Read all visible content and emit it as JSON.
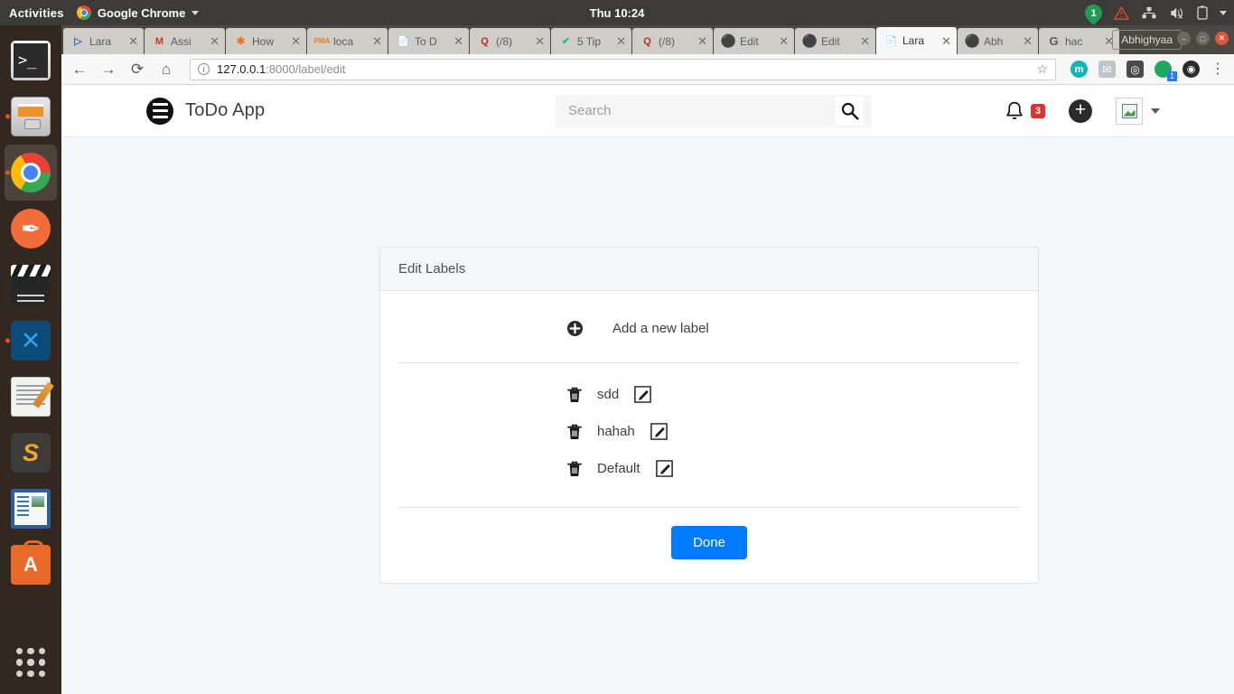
{
  "desktop": {
    "activities_label": "Activities",
    "active_app": "Google Chrome",
    "clock": "Thu 10:24",
    "tray": {
      "message_count": "1",
      "warning_icon": "warning-triangle-icon",
      "network_icon": "network-wired-icon",
      "volume_icon": "volume-muted-icon",
      "battery_icon": "battery-icon",
      "menu_icon": "chevron-down-icon"
    },
    "dock": [
      {
        "name": "terminal",
        "label": "Terminal",
        "glyph": ">_",
        "running": false,
        "active": false
      },
      {
        "name": "files",
        "label": "Files",
        "running": true,
        "active": false
      },
      {
        "name": "google-chrome",
        "label": "Google Chrome",
        "running": true,
        "active": true
      },
      {
        "name": "postman",
        "label": "Postman",
        "running": false,
        "active": false
      },
      {
        "name": "video-editor",
        "label": "Video Editor",
        "running": false,
        "active": false
      },
      {
        "name": "vs-code",
        "label": "Visual Studio Code",
        "running": true,
        "active": false
      },
      {
        "name": "notes",
        "label": "Notes",
        "running": false,
        "active": false
      },
      {
        "name": "sublime-text",
        "label": "Sublime Text",
        "glyph": "S",
        "running": false,
        "active": false
      },
      {
        "name": "libreoffice",
        "label": "LibreOffice",
        "running": false,
        "active": false
      },
      {
        "name": "ubuntu-software",
        "label": "Ubuntu Software",
        "glyph": "A",
        "running": false,
        "active": false
      },
      {
        "name": "show-applications",
        "label": "Show Applications",
        "running": false,
        "active": false
      }
    ]
  },
  "browser": {
    "profile_name": "Abhighyaa",
    "window_controls": {
      "minimize": "–",
      "maximize": "□",
      "close": "✕"
    },
    "tabs": [
      {
        "title": "Lara",
        "favicon": "laravel-icon",
        "active": false
      },
      {
        "title": "Assi",
        "favicon": "gmail-icon",
        "active": false
      },
      {
        "title": "How",
        "favicon": "hover-icon",
        "active": false
      },
      {
        "title": "loca",
        "favicon": "phpmyadmin-icon",
        "active": false
      },
      {
        "title": "To D",
        "favicon": "document-icon",
        "active": false
      },
      {
        "title": "(/8)",
        "favicon": "quora-icon",
        "active": false
      },
      {
        "title": "5 Tip",
        "favicon": "grammarly-icon",
        "active": false
      },
      {
        "title": "(/8)",
        "favicon": "quora-icon",
        "active": false
      },
      {
        "title": "Edit",
        "favicon": "github-icon",
        "active": false
      },
      {
        "title": "Edit",
        "favicon": "github-icon",
        "active": false
      },
      {
        "title": "Lara",
        "favicon": "document-icon",
        "active": true
      },
      {
        "title": "Abh",
        "favicon": "github-icon",
        "active": false
      },
      {
        "title": "hac",
        "favicon": "google-icon",
        "active": false
      }
    ],
    "tab_close_glyph": "✕",
    "nav": {
      "back": "←",
      "forward": "→",
      "reload": "⟳",
      "home": "⌂"
    },
    "omnibox": {
      "site_info_icon": "info-circle-icon",
      "url_host": "127.0.0.1",
      "url_path": ":8000/label/edit",
      "bookmark_icon": "star-icon"
    },
    "extensions": [
      {
        "name": "extension-m",
        "glyph": "m"
      },
      {
        "name": "extension-mail",
        "glyph": "✉"
      },
      {
        "name": "extension-bulb",
        "glyph": "◎"
      },
      {
        "name": "extension-green",
        "glyph": "",
        "badge": "1"
      },
      {
        "name": "extension-dark",
        "glyph": "◉"
      }
    ],
    "menu_glyph": "⋮"
  },
  "app": {
    "brand": {
      "logo_icon": "hamburger-circle-icon",
      "title": "ToDo App"
    },
    "search": {
      "placeholder": "Search",
      "value": "",
      "button_icon": "search-icon"
    },
    "header_right": {
      "notifications_icon": "bell-icon",
      "notifications_count": "3",
      "add_icon": "plus-circle-icon",
      "avatar_icon": "broken-image-avatar",
      "dropdown_icon": "caret-down-icon"
    },
    "card": {
      "title": "Edit Labels",
      "add_row": {
        "icon": "plus-circle-icon",
        "label": "Add a new label"
      },
      "labels": [
        {
          "name": "sdd",
          "delete_icon": "trash-icon",
          "edit_icon": "pencil-square-icon"
        },
        {
          "name": "hahah",
          "delete_icon": "trash-icon",
          "edit_icon": "pencil-square-icon"
        },
        {
          "name": "Default",
          "delete_icon": "trash-icon",
          "edit_icon": "pencil-square-icon"
        }
      ],
      "done_label": "Done"
    }
  },
  "colors": {
    "accent_blue": "#007bff",
    "badge_red": "#e03131",
    "page_bg": "#f4f7f9",
    "card_border": "#dfe3e6"
  }
}
